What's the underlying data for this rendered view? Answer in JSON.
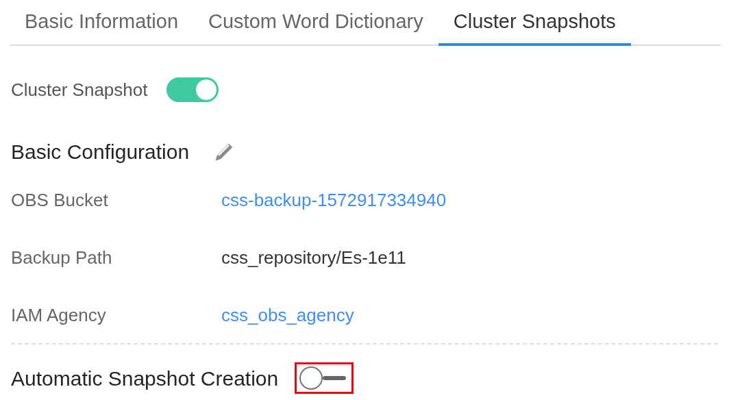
{
  "tabs": [
    {
      "label": "Basic Information",
      "selected": false
    },
    {
      "label": "Custom Word Dictionary",
      "selected": false
    },
    {
      "label": "Cluster Snapshots",
      "selected": true
    }
  ],
  "cluster_snapshot": {
    "label": "Cluster Snapshot",
    "on": true
  },
  "basic_configuration": {
    "title": "Basic Configuration",
    "fields": [
      {
        "label": "OBS Bucket",
        "value": "css-backup-1572917334940",
        "kind": "link"
      },
      {
        "label": "Backup Path",
        "value": "css_repository/Es-1e11",
        "kind": "text"
      },
      {
        "label": "IAM Agency",
        "value": "css_obs_agency",
        "kind": "link"
      }
    ]
  },
  "automatic_snapshot": {
    "label": "Automatic Snapshot Creation",
    "on": false,
    "highlighted": true
  }
}
